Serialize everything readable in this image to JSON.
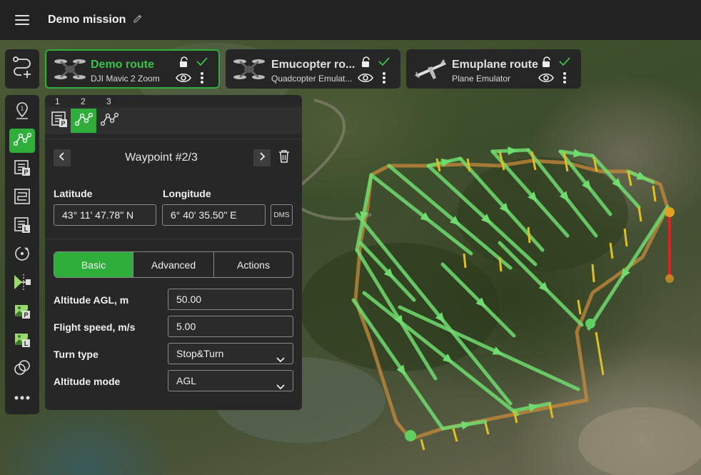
{
  "header": {
    "menu_icon": "hamburger-menu-icon",
    "mission_title": "Demo mission",
    "edit_icon": "pencil-icon"
  },
  "routes": [
    {
      "name": "Demo route",
      "subtitle": "DJI Mavic 2 Zoom",
      "icon": "quadcopter-icon",
      "active": true
    },
    {
      "name": "Emucopter ro...",
      "subtitle": "Quadcopter Emulat...",
      "icon": "quadcopter-icon",
      "active": false
    },
    {
      "name": "Emuplane route",
      "subtitle": "Plane Emulator",
      "icon": "plane-icon",
      "active": false
    }
  ],
  "route_icons": [
    "unlock-icon",
    "check-icon",
    "eye-icon",
    "more-vertical-icon"
  ],
  "toolbar": {
    "top_tool": "route-add-icon",
    "tools": [
      "waypoint-marker-icon",
      "route-segment-icon",
      "parking-waypoint-icon",
      "area-scan-icon",
      "landing-icon",
      "circle-rotate-icon",
      "camera-trigger-icon",
      "photo-parking-icon",
      "photo-landing-icon",
      "overlap-icon",
      "more-horizontal-icon"
    ]
  },
  "panel": {
    "tab_numbers": [
      "1",
      "2",
      "3"
    ],
    "tab_icons": [
      "parking-waypoint-icon",
      "route-segment-icon",
      "route-segment-icon"
    ],
    "waypoint_title": "Waypoint #2/3",
    "latitude_label": "Latitude",
    "longitude_label": "Longitude",
    "latitude_value": "43° 11' 47.78\" N",
    "longitude_value": "6° 40' 35.50\" E",
    "dms_label": "DMS",
    "tabs": [
      "Basic",
      "Advanced",
      "Actions"
    ],
    "active_tab": "Basic",
    "fields": [
      {
        "label": "Altitude AGL, m",
        "value": "50.00",
        "type": "input"
      },
      {
        "label": "Flight speed, m/s",
        "value": "5.00",
        "type": "input"
      },
      {
        "label": "Turn type",
        "value": "Stop&Turn",
        "type": "select"
      },
      {
        "label": "Altitude mode",
        "value": "AGL",
        "type": "select"
      }
    ]
  },
  "colors": {
    "accent": "#2fae3c",
    "panel": "#272727",
    "topbar": "#222222",
    "route_line": "#6fdc6f",
    "boundary": "#c8893a",
    "vertical_marker": "#e0c020",
    "takeoff_line": "#e02020"
  }
}
